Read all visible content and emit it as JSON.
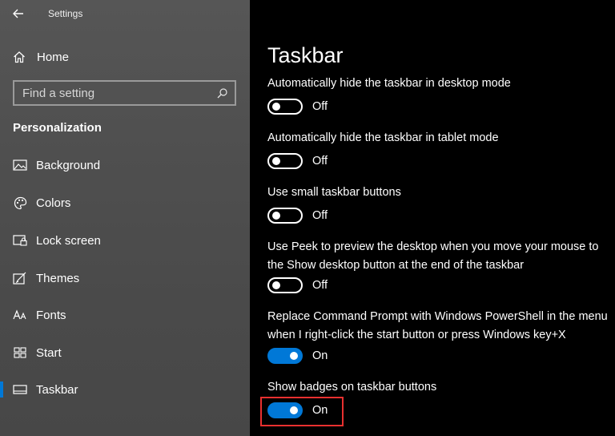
{
  "app": {
    "title": "Settings"
  },
  "sidebar": {
    "home_label": "Home",
    "search_placeholder": "Find a setting",
    "section_title": "Personalization",
    "items": [
      {
        "label": "Background",
        "icon": "image-icon"
      },
      {
        "label": "Colors",
        "icon": "palette-icon"
      },
      {
        "label": "Lock screen",
        "icon": "lock-screen-icon"
      },
      {
        "label": "Themes",
        "icon": "themes-icon"
      },
      {
        "label": "Fonts",
        "icon": "fonts-icon"
      },
      {
        "label": "Start",
        "icon": "start-icon"
      },
      {
        "label": "Taskbar",
        "icon": "taskbar-icon",
        "active": true
      }
    ]
  },
  "main": {
    "title": "Taskbar",
    "settings": [
      {
        "label": "Automatically hide the taskbar in desktop mode",
        "on": false,
        "state": "Off"
      },
      {
        "label": "Automatically hide the taskbar in tablet mode",
        "on": false,
        "state": "Off"
      },
      {
        "label": "Use small taskbar buttons",
        "on": false,
        "state": "Off"
      },
      {
        "label": "Use Peek to preview the desktop when you move your mouse to the Show desktop button at the end of the taskbar",
        "on": false,
        "state": "Off"
      },
      {
        "label": "Replace Command Prompt with Windows PowerShell in the menu when I right-click the start button or press Windows key+X",
        "on": true,
        "state": "On"
      },
      {
        "label": "Show badges on taskbar buttons",
        "on": true,
        "state": "On"
      }
    ]
  },
  "colors": {
    "accent": "#0078d7",
    "highlight": "#e8302f"
  }
}
